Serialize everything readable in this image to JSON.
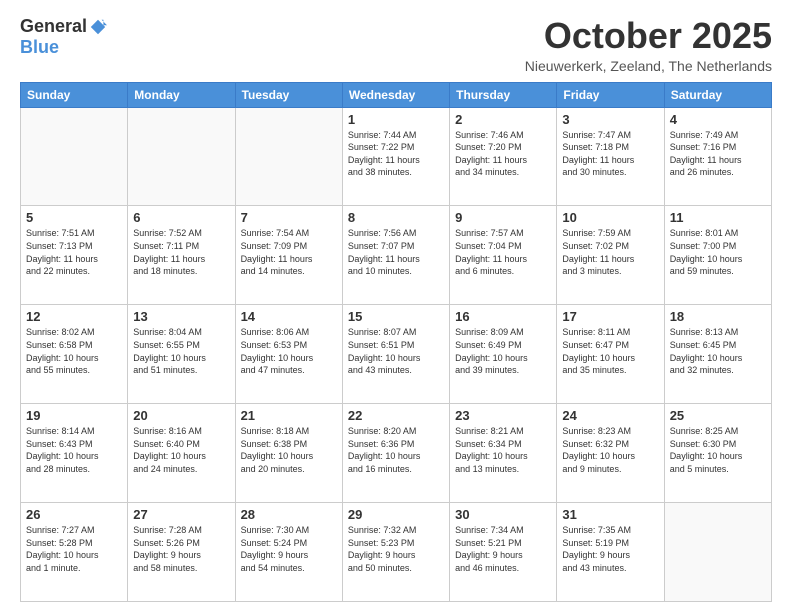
{
  "logo": {
    "general": "General",
    "blue": "Blue"
  },
  "title": "October 2025",
  "subtitle": "Nieuwerkerk, Zeeland, The Netherlands",
  "days_of_week": [
    "Sunday",
    "Monday",
    "Tuesday",
    "Wednesday",
    "Thursday",
    "Friday",
    "Saturday"
  ],
  "weeks": [
    [
      {
        "day": "",
        "info": ""
      },
      {
        "day": "",
        "info": ""
      },
      {
        "day": "",
        "info": ""
      },
      {
        "day": "1",
        "info": "Sunrise: 7:44 AM\nSunset: 7:22 PM\nDaylight: 11 hours\nand 38 minutes."
      },
      {
        "day": "2",
        "info": "Sunrise: 7:46 AM\nSunset: 7:20 PM\nDaylight: 11 hours\nand 34 minutes."
      },
      {
        "day": "3",
        "info": "Sunrise: 7:47 AM\nSunset: 7:18 PM\nDaylight: 11 hours\nand 30 minutes."
      },
      {
        "day": "4",
        "info": "Sunrise: 7:49 AM\nSunset: 7:16 PM\nDaylight: 11 hours\nand 26 minutes."
      }
    ],
    [
      {
        "day": "5",
        "info": "Sunrise: 7:51 AM\nSunset: 7:13 PM\nDaylight: 11 hours\nand 22 minutes."
      },
      {
        "day": "6",
        "info": "Sunrise: 7:52 AM\nSunset: 7:11 PM\nDaylight: 11 hours\nand 18 minutes."
      },
      {
        "day": "7",
        "info": "Sunrise: 7:54 AM\nSunset: 7:09 PM\nDaylight: 11 hours\nand 14 minutes."
      },
      {
        "day": "8",
        "info": "Sunrise: 7:56 AM\nSunset: 7:07 PM\nDaylight: 11 hours\nand 10 minutes."
      },
      {
        "day": "9",
        "info": "Sunrise: 7:57 AM\nSunset: 7:04 PM\nDaylight: 11 hours\nand 6 minutes."
      },
      {
        "day": "10",
        "info": "Sunrise: 7:59 AM\nSunset: 7:02 PM\nDaylight: 11 hours\nand 3 minutes."
      },
      {
        "day": "11",
        "info": "Sunrise: 8:01 AM\nSunset: 7:00 PM\nDaylight: 10 hours\nand 59 minutes."
      }
    ],
    [
      {
        "day": "12",
        "info": "Sunrise: 8:02 AM\nSunset: 6:58 PM\nDaylight: 10 hours\nand 55 minutes."
      },
      {
        "day": "13",
        "info": "Sunrise: 8:04 AM\nSunset: 6:55 PM\nDaylight: 10 hours\nand 51 minutes."
      },
      {
        "day": "14",
        "info": "Sunrise: 8:06 AM\nSunset: 6:53 PM\nDaylight: 10 hours\nand 47 minutes."
      },
      {
        "day": "15",
        "info": "Sunrise: 8:07 AM\nSunset: 6:51 PM\nDaylight: 10 hours\nand 43 minutes."
      },
      {
        "day": "16",
        "info": "Sunrise: 8:09 AM\nSunset: 6:49 PM\nDaylight: 10 hours\nand 39 minutes."
      },
      {
        "day": "17",
        "info": "Sunrise: 8:11 AM\nSunset: 6:47 PM\nDaylight: 10 hours\nand 35 minutes."
      },
      {
        "day": "18",
        "info": "Sunrise: 8:13 AM\nSunset: 6:45 PM\nDaylight: 10 hours\nand 32 minutes."
      }
    ],
    [
      {
        "day": "19",
        "info": "Sunrise: 8:14 AM\nSunset: 6:43 PM\nDaylight: 10 hours\nand 28 minutes."
      },
      {
        "day": "20",
        "info": "Sunrise: 8:16 AM\nSunset: 6:40 PM\nDaylight: 10 hours\nand 24 minutes."
      },
      {
        "day": "21",
        "info": "Sunrise: 8:18 AM\nSunset: 6:38 PM\nDaylight: 10 hours\nand 20 minutes."
      },
      {
        "day": "22",
        "info": "Sunrise: 8:20 AM\nSunset: 6:36 PM\nDaylight: 10 hours\nand 16 minutes."
      },
      {
        "day": "23",
        "info": "Sunrise: 8:21 AM\nSunset: 6:34 PM\nDaylight: 10 hours\nand 13 minutes."
      },
      {
        "day": "24",
        "info": "Sunrise: 8:23 AM\nSunset: 6:32 PM\nDaylight: 10 hours\nand 9 minutes."
      },
      {
        "day": "25",
        "info": "Sunrise: 8:25 AM\nSunset: 6:30 PM\nDaylight: 10 hours\nand 5 minutes."
      }
    ],
    [
      {
        "day": "26",
        "info": "Sunrise: 7:27 AM\nSunset: 5:28 PM\nDaylight: 10 hours\nand 1 minute."
      },
      {
        "day": "27",
        "info": "Sunrise: 7:28 AM\nSunset: 5:26 PM\nDaylight: 9 hours\nand 58 minutes."
      },
      {
        "day": "28",
        "info": "Sunrise: 7:30 AM\nSunset: 5:24 PM\nDaylight: 9 hours\nand 54 minutes."
      },
      {
        "day": "29",
        "info": "Sunrise: 7:32 AM\nSunset: 5:23 PM\nDaylight: 9 hours\nand 50 minutes."
      },
      {
        "day": "30",
        "info": "Sunrise: 7:34 AM\nSunset: 5:21 PM\nDaylight: 9 hours\nand 46 minutes."
      },
      {
        "day": "31",
        "info": "Sunrise: 7:35 AM\nSunset: 5:19 PM\nDaylight: 9 hours\nand 43 minutes."
      },
      {
        "day": "",
        "info": ""
      }
    ]
  ]
}
